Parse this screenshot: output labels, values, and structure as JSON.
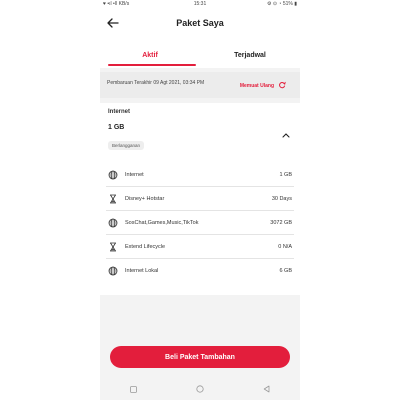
{
  "status_bar": {
    "left": "♥ •ıl •Il KB/s",
    "time": "15:31",
    "right": "⚙ ⊙ ◔ 51% ▮"
  },
  "header": {
    "title": "Paket Saya"
  },
  "tabs": [
    {
      "label": "Aktif",
      "active": true
    },
    {
      "label": "Terjadwal",
      "active": false
    }
  ],
  "info": {
    "last_update": "Pembaruan Terakhir 09 Agt 2021, 03:34 PM",
    "refresh_label": "Memuat Ulang"
  },
  "package": {
    "category": "Internet",
    "amount": "1 GB",
    "badge": "Berlangganan",
    "items": [
      {
        "icon": "globe-icon",
        "name": "Internet",
        "value": "1 GB"
      },
      {
        "icon": "hourglass-icon",
        "name": "Disney+ Hotstar",
        "value": "30 Days"
      },
      {
        "icon": "globe-icon",
        "name": "SosChat,Games,Music,TikTok",
        "value": "3072 GB"
      },
      {
        "icon": "hourglass-icon",
        "name": "Extend Lifecycle",
        "value": "0 N/A"
      },
      {
        "icon": "globe-icon",
        "name": "Internet Lokal",
        "value": "6 GB"
      }
    ]
  },
  "cta": {
    "label": "Beli Paket Tambahan"
  },
  "colors": {
    "accent": "#e31e3c",
    "background": "#f3f3f3"
  }
}
